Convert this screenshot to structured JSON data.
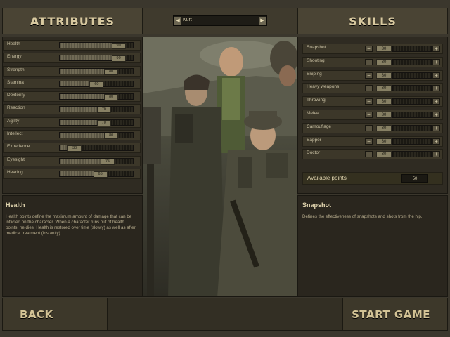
{
  "attributes": {
    "title": "ATTRIBUTES",
    "items": [
      {
        "label": "Health",
        "value": 90
      },
      {
        "label": "Energy",
        "value": 90
      },
      {
        "label": "Strength",
        "value": 80
      },
      {
        "label": "Stamina",
        "value": 60
      },
      {
        "label": "Dexterity",
        "value": 80
      },
      {
        "label": "Reaction",
        "value": 70
      },
      {
        "label": "Agility",
        "value": 70
      },
      {
        "label": "Intellect",
        "value": 80
      },
      {
        "label": "Experience",
        "value": 30
      },
      {
        "label": "Eyesight",
        "value": 75
      },
      {
        "label": "Hearing",
        "value": 65
      }
    ]
  },
  "character": {
    "name": "Kurt"
  },
  "skills": {
    "title": "SKILLS",
    "items": [
      {
        "label": "Snapshot",
        "value": 30
      },
      {
        "label": "Shooting",
        "value": 30
      },
      {
        "label": "Sniping",
        "value": 30
      },
      {
        "label": "Heavy weapons",
        "value": 30
      },
      {
        "label": "Throwing",
        "value": 30
      },
      {
        "label": "Melee",
        "value": 30
      },
      {
        "label": "Camouflage",
        "value": 30
      },
      {
        "label": "Sapper",
        "value": 30
      },
      {
        "label": "Doctor",
        "value": 30
      }
    ],
    "available_label": "Available points",
    "available_value": "50"
  },
  "descriptions": {
    "attribute_title": "Health",
    "attribute_text": "Health points define the maximum amount of damage that can be inflicted on the character. When a character runs out of health points, he dies. Health is restored over time (slowly) as well as after medical treatment (instantly).",
    "skill_title": "Snapshot",
    "skill_text": "Defines the effectiveness of snapshots and shots from the hip."
  },
  "footer": {
    "back_label": "BACK",
    "start_label": "START GAME"
  },
  "colors": {
    "accent": "#d8c9a0",
    "panel": "#2f2b22",
    "value_chip": "#878064"
  }
}
